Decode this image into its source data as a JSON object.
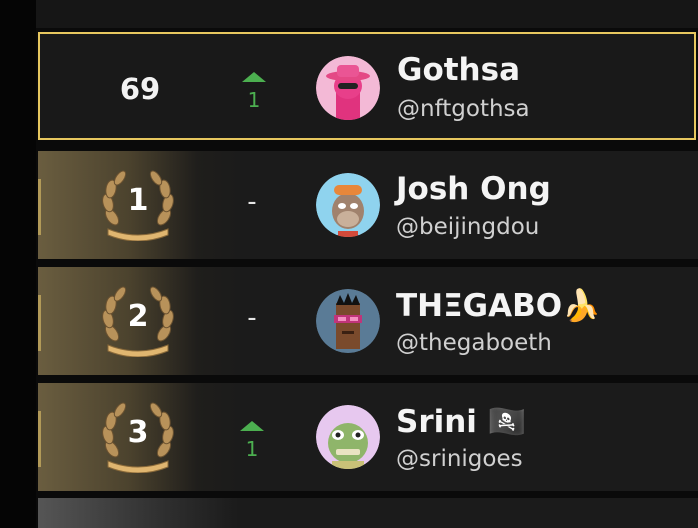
{
  "current_user": {
    "rank": "69",
    "change": "1",
    "name": "Gothsa",
    "handle": "@nftgothsa"
  },
  "entries": [
    {
      "rank": "1",
      "change": "-",
      "name": "Josh Ong",
      "handle": "@beijingdou",
      "emoji": ""
    },
    {
      "rank": "2",
      "change": "-",
      "name": "THΞGABO",
      "handle": "@thegaboeth",
      "emoji": "🍌"
    },
    {
      "rank": "3",
      "change": "1",
      "name": "Srini",
      "handle": "@srinigoes",
      "emoji": "🏴‍☠️"
    }
  ],
  "colors": {
    "highlight_border": "#e7c75f",
    "change_up": "#4caf50",
    "row_bg": "#1b1b1b"
  }
}
